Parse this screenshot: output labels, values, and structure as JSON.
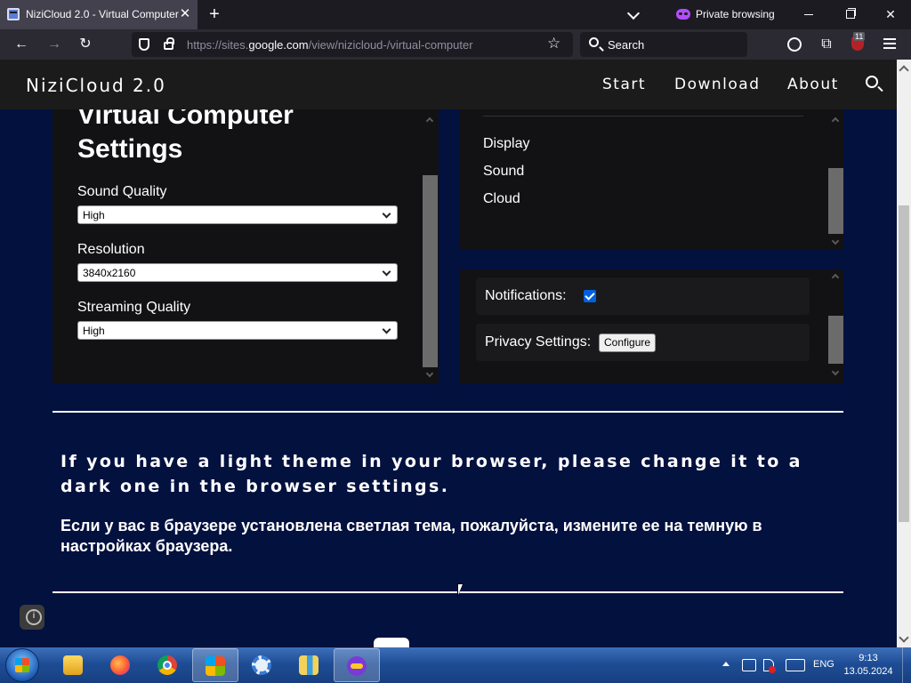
{
  "browser": {
    "tab_title": "NiziCloud 2.0 - Virtual Computer",
    "private_label": "Private browsing",
    "url_prefix": "https://sites.",
    "url_host": "google.com",
    "url_path": "/view/nizicloud-/virtual-computer",
    "search_placeholder": "Search",
    "ublock_count": "11"
  },
  "site": {
    "brand": "NiziCloud 2.0",
    "nav": [
      "Start",
      "Download",
      "About"
    ]
  },
  "settings_panel": {
    "title": "Virtual Computer Settings",
    "fields": [
      {
        "label": "Sound Quality",
        "value": "High"
      },
      {
        "label": "Resolution",
        "value": "3840x2160"
      },
      {
        "label": "Streaming Quality",
        "value": "High"
      }
    ]
  },
  "menu_panel": {
    "items": [
      "Display",
      "Sound",
      "Cloud"
    ]
  },
  "options_panel": {
    "notifications_label": "Notifications:",
    "notifications_checked": true,
    "privacy_label": "Privacy Settings:",
    "configure_label": "Configure"
  },
  "notice": {
    "english": "If you have a light theme in your browser, please change it to a dark one in the browser settings.",
    "russian": "Если у вас в браузере установлена светлая тема, пожалуйста, измените ее на темную в настройках браузера."
  },
  "taskbar": {
    "apps": [
      "file-explorer",
      "firefox",
      "chrome",
      "windows-explorer",
      "settings",
      "archive",
      "firefox-private"
    ],
    "active_apps": [
      "windows-explorer",
      "firefox-private"
    ],
    "language": "ENG",
    "time": "9:13",
    "date": "13.05.2024"
  }
}
